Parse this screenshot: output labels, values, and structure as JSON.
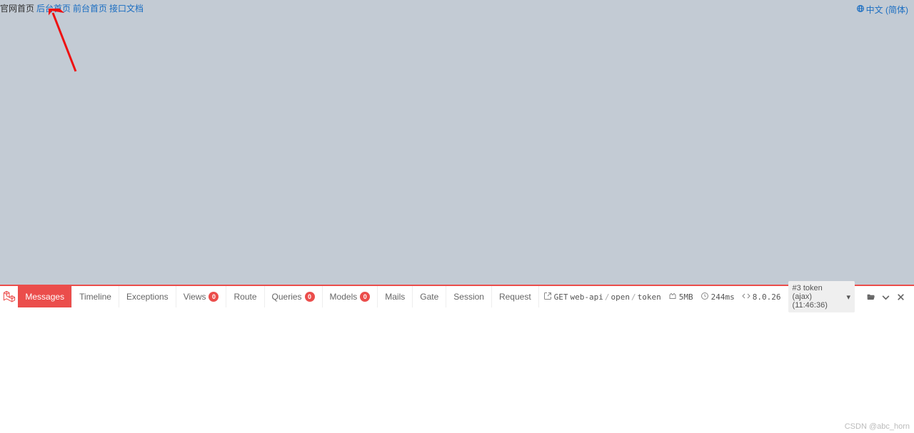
{
  "topnav": {
    "static_label": "官网首页",
    "links": [
      {
        "label": "后台首页"
      },
      {
        "label": "前台首页"
      },
      {
        "label": "接口文档"
      }
    ]
  },
  "language": {
    "label": "中文 (简体)"
  },
  "debugbar": {
    "tabs": {
      "messages": "Messages",
      "timeline": "Timeline",
      "exceptions": "Exceptions",
      "views": "Views",
      "views_badge": "0",
      "route": "Route",
      "queries": "Queries",
      "queries_badge": "0",
      "models": "Models",
      "models_badge": "0",
      "mails": "Mails",
      "gate": "Gate",
      "session": "Session",
      "request": "Request"
    },
    "route": {
      "method": "GET",
      "segments": [
        "web-api",
        "open",
        "token"
      ]
    },
    "memory": "5MB",
    "time": "244ms",
    "php": "8.0.26",
    "history_selector": "#3 token (ajax) (11:46:36)"
  },
  "watermark": "CSDN @abc_horn"
}
